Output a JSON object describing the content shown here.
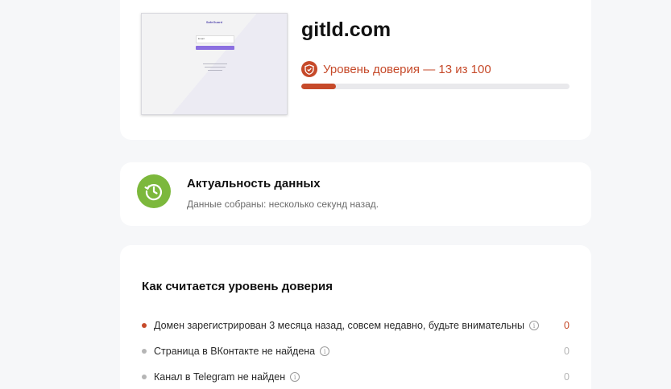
{
  "site": {
    "domain": "gitld.com",
    "trust_label": "Уровень доверия — 13 из 100",
    "trust_score": 13,
    "trust_max": 100,
    "accent_color": "#c64a2a",
    "preview": {
      "logo_text": "SafeGuard",
      "input_text": "Email"
    }
  },
  "freshness": {
    "title": "Актуальность данных",
    "subtitle": "Данные собраны: несколько секунд назад.",
    "icon": "history-clock-icon",
    "color": "#7cb83c"
  },
  "calculation": {
    "title": "Как считается уровень доверия",
    "factors": [
      {
        "text": "Домен зарегистрирован 3 месяца назад, совсем недавно, будьте внимательны",
        "score": "0",
        "status": "negative",
        "dot_color": "#c64a2a"
      },
      {
        "text": "Страница в ВКонтакте не найдена",
        "score": "0",
        "status": "neutral",
        "dot_color": "#b5b5b5"
      },
      {
        "text": "Канал в Telegram не найден",
        "score": "0",
        "status": "neutral",
        "dot_color": "#b5b5b5"
      }
    ]
  }
}
